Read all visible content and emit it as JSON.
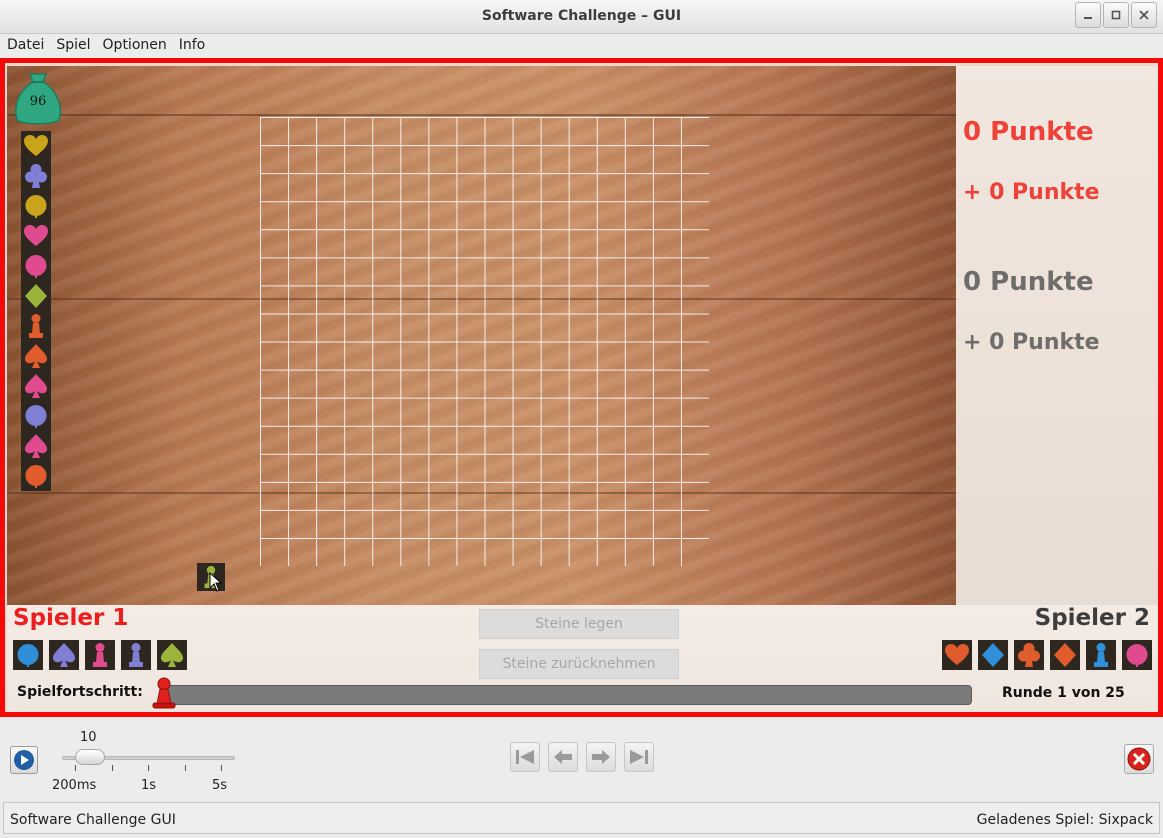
{
  "window": {
    "title": "Software Challenge – GUI"
  },
  "menu": {
    "items": [
      "Datei",
      "Spiel",
      "Optionen",
      "Info"
    ]
  },
  "board": {
    "bag_count": "96",
    "grid_size": 16,
    "stack_tiles": [
      {
        "shape": "heart",
        "color": "#c9a41b"
      },
      {
        "shape": "club",
        "color": "#7f7fd6"
      },
      {
        "shape": "circle",
        "color": "#c9a41b"
      },
      {
        "shape": "heart",
        "color": "#e04a8f"
      },
      {
        "shape": "circle",
        "color": "#e04a8f"
      },
      {
        "shape": "diamond",
        "color": "#9bb43b"
      },
      {
        "shape": "pawn",
        "color": "#e05c2c"
      },
      {
        "shape": "spade",
        "color": "#e05c2c"
      },
      {
        "shape": "spade",
        "color": "#e04a8f"
      },
      {
        "shape": "circle",
        "color": "#7f7fd6"
      },
      {
        "shape": "spade",
        "color": "#e04a8f"
      },
      {
        "shape": "circle",
        "color": "#e05c2c"
      }
    ],
    "loose_tile": {
      "shape": "pawn",
      "color": "#9bb43b"
    }
  },
  "scores": {
    "player1_points": "0 Punkte",
    "player1_delta": "+ 0 Punkte",
    "player2_points": "0 Punkte",
    "player2_delta": "+ 0 Punkte",
    "player1_color": "#ef4138",
    "player2_color": "#6f6d6b"
  },
  "players": {
    "player1": {
      "name": "Spieler 1",
      "hand": [
        {
          "shape": "circle",
          "color": "#2f8fd8"
        },
        {
          "shape": "spade",
          "color": "#7f7fd6"
        },
        {
          "shape": "pawn",
          "color": "#e04a8f"
        },
        {
          "shape": "pawn",
          "color": "#7f7fd6"
        },
        {
          "shape": "spade",
          "color": "#9bb43b"
        }
      ]
    },
    "player2": {
      "name": "Spieler 2",
      "hand": [
        {
          "shape": "heart",
          "color": "#e05c2c"
        },
        {
          "shape": "diamond",
          "color": "#2f8fd8"
        },
        {
          "shape": "club",
          "color": "#e05c2c"
        },
        {
          "shape": "diamond",
          "color": "#e05c2c"
        },
        {
          "shape": "pawn",
          "color": "#2f8fd8"
        },
        {
          "shape": "circle",
          "color": "#e04a8f"
        }
      ]
    }
  },
  "actions": {
    "place_stones": "Steine legen",
    "undo_stones": "Steine zurücknehmen"
  },
  "progress": {
    "label": "Spielfortschritt:",
    "round_text": "Runde 1 von 25",
    "fraction": 0.0
  },
  "playback": {
    "speed_value": "10",
    "tick_labels": [
      "200ms",
      "1s",
      "5s"
    ]
  },
  "statusbar": {
    "left": "Software Challenge GUI",
    "right": "Geladenes Spiel: Sixpack"
  }
}
